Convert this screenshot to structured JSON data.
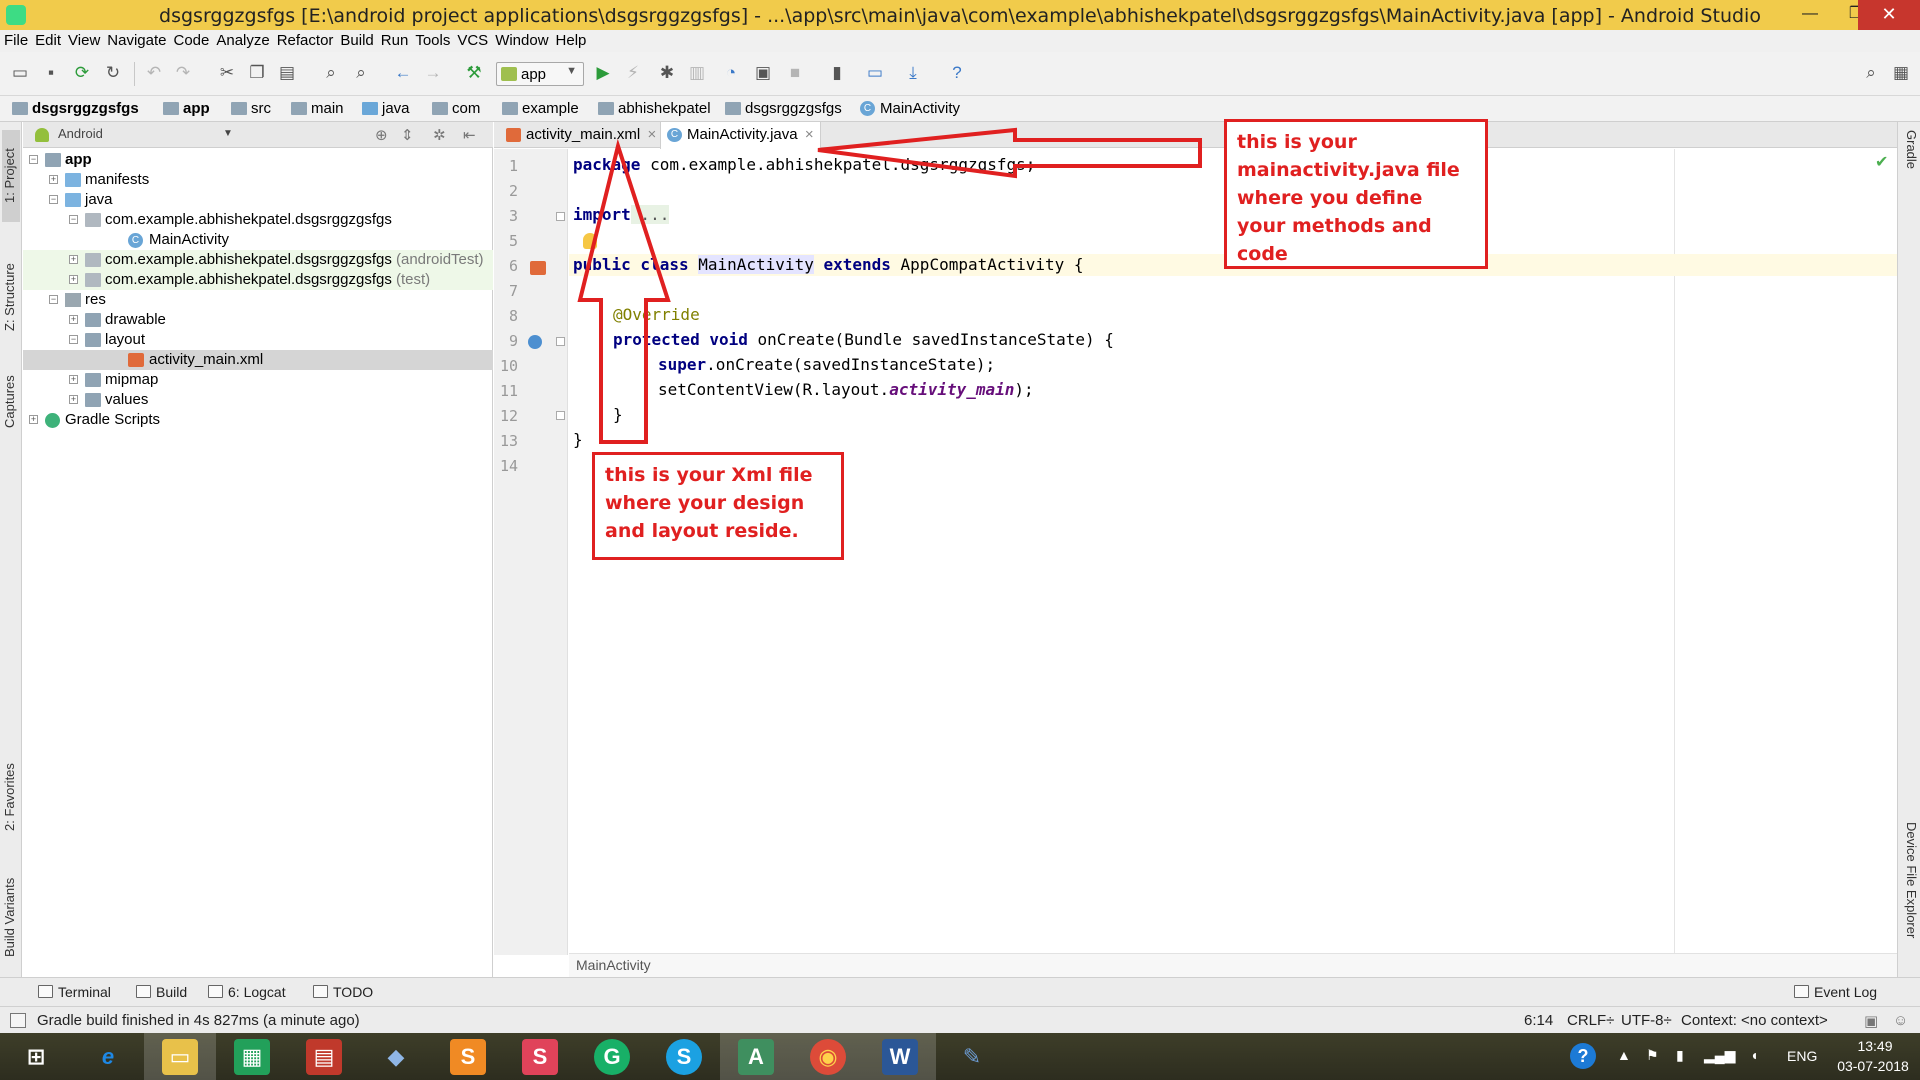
{
  "window": {
    "title": "dsgsrggzgsfgs [E:\\android project applications\\dsgsrggzgsfgs] - ...\\app\\src\\main\\java\\com\\example\\abhishekpatel\\dsgsrggzgsfgs\\MainActivity.java [app] - Android Studio",
    "minimize_glyph": "—",
    "maximize_glyph": "❐",
    "close_glyph": "✕"
  },
  "menu": [
    "File",
    "Edit",
    "View",
    "Navigate",
    "Code",
    "Analyze",
    "Refactor",
    "Build",
    "Run",
    "Tools",
    "VCS",
    "Window",
    "Help"
  ],
  "toolbar": {
    "run_config": "app",
    "icons": [
      "open-icon",
      "save-icon",
      "sync-icon",
      "refresh-icon",
      "undo-icon",
      "redo-icon",
      "cut-icon",
      "copy-icon",
      "paste-icon",
      "find-icon",
      "replace-icon",
      "back-icon",
      "forward-icon",
      "make-project-icon",
      "run-icon",
      "apply-changes-icon",
      "debug-icon",
      "profile-icon",
      "attach-icon",
      "coverage-icon",
      "stop-icon",
      "sync-gradle-icon",
      "avd-manager-icon",
      "sdk-manager-icon",
      "help-icon",
      "search-everywhere-icon"
    ],
    "help_glyph": "?",
    "search_glyph": "⌕"
  },
  "breadcrumbs": [
    "dsgsrggzgsfgs",
    "app",
    "src",
    "main",
    "java",
    "com",
    "example",
    "abhishekpatel",
    "dsgsrggzgsfgs",
    "MainActivity"
  ],
  "left_strip": {
    "tabs": [
      "1: Project",
      "Z: Structure",
      "Captures",
      "2: Favorites",
      "Build Variants"
    ]
  },
  "right_strip": {
    "tabs": [
      "Gradle",
      "Device File Explorer"
    ]
  },
  "project_panel": {
    "view": "Android",
    "tree": [
      {
        "label": "app",
        "suffix": "",
        "bold": true
      },
      {
        "label": "manifests",
        "suffix": ""
      },
      {
        "label": "java",
        "suffix": ""
      },
      {
        "label": "com.example.abhishekpatel.dsgsrggzgsfgs",
        "suffix": ""
      },
      {
        "label": "MainActivity",
        "suffix": ""
      },
      {
        "label": "com.example.abhishekpatel.dsgsrggzgsfgs",
        "suffix": "(androidTest)"
      },
      {
        "label": "com.example.abhishekpatel.dsgsrggzgsfgs",
        "suffix": "(test)"
      },
      {
        "label": "res",
        "suffix": ""
      },
      {
        "label": "drawable",
        "suffix": ""
      },
      {
        "label": "layout",
        "suffix": ""
      },
      {
        "label": "activity_main.xml",
        "suffix": ""
      },
      {
        "label": "mipmap",
        "suffix": ""
      },
      {
        "label": "values",
        "suffix": ""
      },
      {
        "label": "Gradle Scripts",
        "suffix": ""
      }
    ]
  },
  "editor": {
    "tabs": [
      {
        "label": "activity_main.xml",
        "active": false
      },
      {
        "label": "MainActivity.java",
        "active": true
      }
    ],
    "line_numbers": [
      "1",
      "2",
      "3",
      "5",
      "6",
      "7",
      "8",
      "9",
      "10",
      "11",
      "12",
      "13",
      "14"
    ],
    "code": {
      "l1_kw": "package",
      "l1_rest": " com.example.abhishekpatel.dsgsrggzgsfgs;",
      "l3_kw": "import",
      "l3_fold": " ...",
      "l6_kw1": "public class",
      "l6_name": "MainActivity",
      "l6_kw2": "extends",
      "l6_rest": " AppCompatActivity {",
      "l8_ann": "@Override",
      "l9_kw": "protected void",
      "l9_rest": " onCreate(Bundle savedInstanceState) {",
      "l10_kw": "super",
      "l10_rest": ".onCreate(savedInstanceState);",
      "l11_pre": "setContentView(R.layout.",
      "l11_field": "activity_main",
      "l11_post": ");",
      "l12": "}",
      "l13": "}"
    },
    "footer_crumb": "MainActivity",
    "inspection_ok_glyph": "✔"
  },
  "bottom_tools": [
    {
      "label": "Terminal"
    },
    {
      "label": "Build"
    },
    {
      "label": "6: Logcat"
    },
    {
      "label": "TODO"
    },
    {
      "label": "Event Log"
    }
  ],
  "status": {
    "message": "Gradle build finished in 4s 827ms (a minute ago)",
    "position": "6:14",
    "line_sep": "CRLF÷",
    "encoding": "UTF-8÷",
    "context": "Context: <no context>"
  },
  "annotations": {
    "java_note": "this is your mainactivity.java file where you define your methods and code",
    "xml_note": "this is your Xml file where your design and layout reside.",
    "color": "#e02020"
  },
  "taskbar": {
    "apps": [
      {
        "name": "start",
        "glyph": "⊞",
        "color": "#ffffff"
      },
      {
        "name": "internet-explorer",
        "glyph": "e",
        "color": "#1e88e5"
      },
      {
        "name": "file-explorer",
        "glyph": "▭",
        "color": "#e8c14a"
      },
      {
        "name": "store",
        "glyph": "▦",
        "color": "#22a05a"
      },
      {
        "name": "news",
        "glyph": "▤",
        "color": "#c0392b"
      },
      {
        "name": "virtualbox",
        "glyph": "◆",
        "color": "#5b8fd6"
      },
      {
        "name": "sublime",
        "glyph": "S",
        "color": "#f08a24"
      },
      {
        "name": "slides",
        "glyph": "S",
        "color": "#e0435a"
      },
      {
        "name": "grammarly",
        "glyph": "G",
        "color": "#18b067"
      },
      {
        "name": "skype",
        "glyph": "S",
        "color": "#1ba1e2"
      },
      {
        "name": "android-studio",
        "glyph": "A",
        "color": "#3f8f5f"
      },
      {
        "name": "chrome",
        "glyph": "◉",
        "color": "#dd4b39"
      },
      {
        "name": "word",
        "glyph": "W",
        "color": "#2b5797"
      },
      {
        "name": "paint",
        "glyph": "✎",
        "color": "#6c9bd2"
      }
    ],
    "tray": {
      "help_glyph": "?",
      "lang": "ENG",
      "time": "13:49",
      "date": "03-07-2018"
    }
  }
}
